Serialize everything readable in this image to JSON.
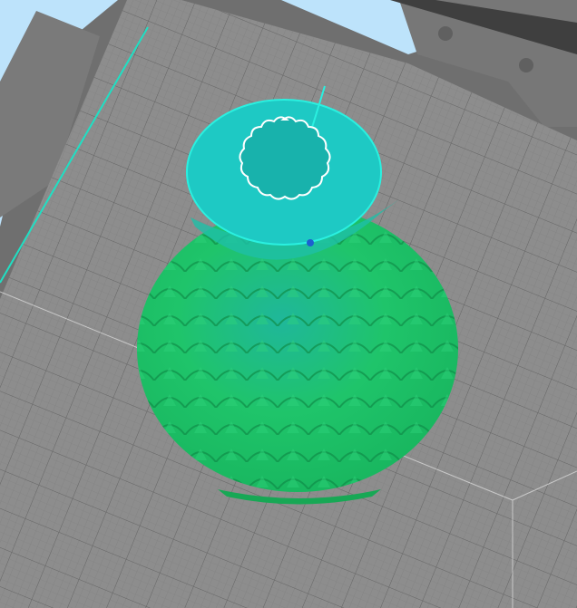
{
  "viewport": {
    "sky_color": "#bde3fb",
    "plate_color": "#8d8d8d",
    "frame_color": "#6f6f6f",
    "model_body_color": "#1fc46a",
    "model_selected_color": "#1ec9c4",
    "outline_color": "#2af0e0"
  }
}
